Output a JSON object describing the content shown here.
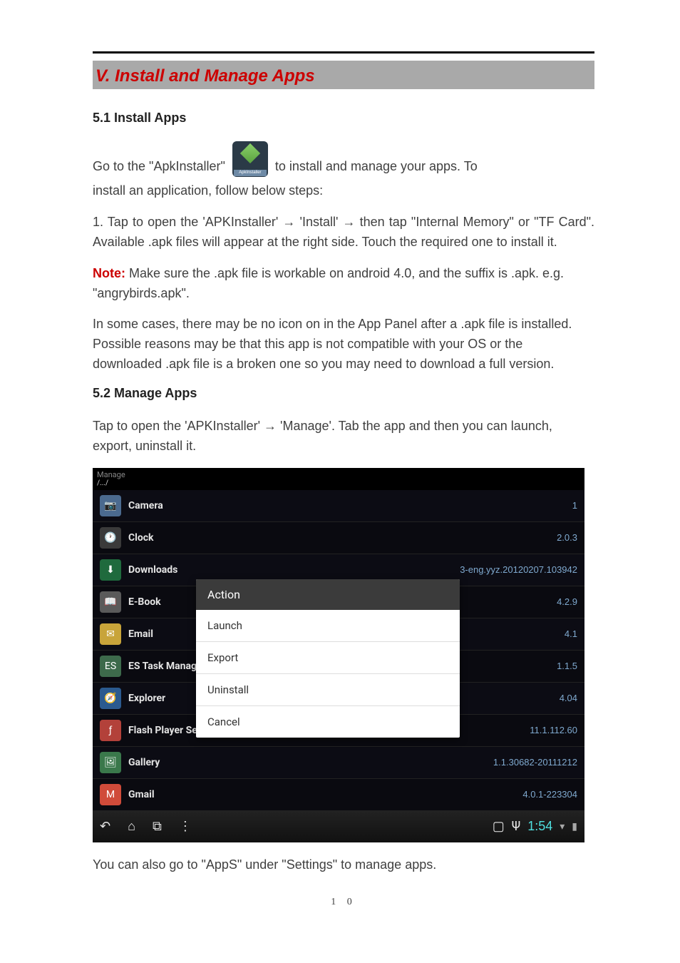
{
  "section": {
    "title": "V. Install and Manage Apps"
  },
  "h51": "5.1 Install Apps",
  "p1a": "Go to the \"ApkInstaller\"",
  "apk_icon_label": "ApkInstaller",
  "p1b": " to install and manage your apps. To",
  "p1c": "install an application, follow below steps:",
  "p2_pref": "    ",
  "p2": "1. Tap to open the 'APKInstaller' → 'Install' → then tap \"Internal Memory\" or \"TF Card\". Available .apk files will appear at the right side. Touch the required one to install it.",
  "note_label": "Note:",
  "note_body": " Make sure the .apk file is workable on android 4.0, and the suffix is .apk. e.g. \"angrybirds.apk\".",
  "p3": "In some cases, there may be no icon on in the App Panel after a .apk file is installed. Possible reasons may be that this app is not compatible with your OS or the downloaded .apk file is a broken one so you may need to download a full version.",
  "h52": "5.2 Manage Apps",
  "p4": "Tap to open the 'APKInstaller' → 'Manage'. Tab the app and then you can launch, export, uninstall it.",
  "android": {
    "screen_title": "Manage",
    "path": "/.../",
    "apps": [
      {
        "name": "Camera",
        "ver": "1",
        "iconBg": "#4b6a8f",
        "iconTxt": "📷"
      },
      {
        "name": "Clock",
        "ver": "2.0.3",
        "iconBg": "#3a3a3a",
        "iconTxt": "🕐"
      },
      {
        "name": "Downloads",
        "ver": "3-eng.yyz.20120207.103942",
        "iconBg": "#1f6a3d",
        "iconTxt": "⬇"
      },
      {
        "name": "E-Book",
        "ver": "4.2.9",
        "iconBg": "#5a5a5a",
        "iconTxt": "📖"
      },
      {
        "name": "Email",
        "ver": "4.1",
        "iconBg": "#c8a43a",
        "iconTxt": "✉"
      },
      {
        "name": "ES Task Manager",
        "ver": "1.1.5",
        "iconBg": "#3d6a4b",
        "iconTxt": "ES"
      },
      {
        "name": "Explorer",
        "ver": "4.04",
        "iconBg": "#2b5a8f",
        "iconTxt": "🧭"
      },
      {
        "name": "Flash Player Settings",
        "ver": "11.1.112.60",
        "iconBg": "#b3413a",
        "iconTxt": "ƒ"
      },
      {
        "name": "Gallery",
        "ver": "1.1.30682-20111212",
        "iconBg": "#3a784b",
        "iconTxt": "🖼"
      },
      {
        "name": "Gmail",
        "ver": "4.0.1-223304",
        "iconBg": "#d04b3a",
        "iconTxt": "M"
      }
    ],
    "action": {
      "title": "Action",
      "items": [
        {
          "label": "Launch"
        },
        {
          "label": "Export"
        },
        {
          "label": "Uninstall"
        },
        {
          "label": "Cancel"
        }
      ]
    },
    "status": {
      "clock": "1:54"
    }
  },
  "p5": "You can also go to \"AppS\" under \"Settings\" to manage apps.",
  "page_no": "1 0"
}
